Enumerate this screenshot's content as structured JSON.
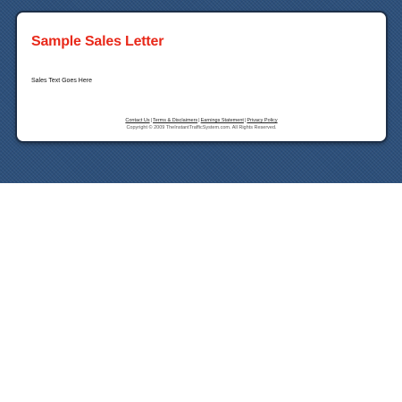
{
  "page": {
    "title": "Sample Sales Letter",
    "title_color": "#e8291a",
    "body_text": "Sales Text Goes Here",
    "background_color": "#2c4f7a"
  },
  "footer": {
    "links": [
      {
        "label": "Contact Us"
      },
      {
        "label": "Terms & Disclaimers"
      },
      {
        "label": "Earnings Statement"
      },
      {
        "label": "Privacy Policy"
      }
    ],
    "separator": "|",
    "copyright": "Copyright © 2009 TheInstantTrafficSystem.com. All Rights Reserved."
  }
}
